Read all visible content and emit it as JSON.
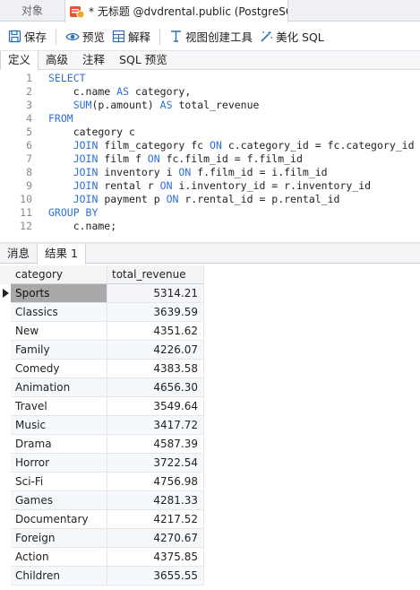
{
  "window_tabs": {
    "objects_label": "对象",
    "query_title": "* 无标题 @dvdrental.public (PostgreSQ..."
  },
  "toolbar": {
    "save_label": "保存",
    "preview_label": "预览",
    "explain_label": "解释",
    "view_builder_label": "视图创建工具",
    "beautify_label": "美化 SQL"
  },
  "sub_tabs": [
    "定义",
    "高级",
    "注释",
    "SQL 预览"
  ],
  "code": {
    "lines": [
      {
        "n": "1",
        "parts": [
          {
            "t": "SELECT",
            "k": true
          }
        ]
      },
      {
        "n": "2",
        "parts": [
          {
            "t": "    c.name ",
            "k": false
          },
          {
            "t": "AS",
            "k": true
          },
          {
            "t": " category,",
            "k": false
          }
        ]
      },
      {
        "n": "3",
        "parts": [
          {
            "t": "    ",
            "k": false
          },
          {
            "t": "SUM",
            "k": true
          },
          {
            "t": "(p.amount) ",
            "k": false
          },
          {
            "t": "AS",
            "k": true
          },
          {
            "t": " total_revenue",
            "k": false
          }
        ]
      },
      {
        "n": "4",
        "parts": [
          {
            "t": "FROM",
            "k": true
          }
        ]
      },
      {
        "n": "5",
        "parts": [
          {
            "t": "    category c",
            "k": false
          }
        ]
      },
      {
        "n": "6",
        "parts": [
          {
            "t": "    ",
            "k": false
          },
          {
            "t": "JOIN",
            "k": true
          },
          {
            "t": " film_category fc ",
            "k": false
          },
          {
            "t": "ON",
            "k": true
          },
          {
            "t": " c.category_id = fc.category_id",
            "k": false
          }
        ]
      },
      {
        "n": "7",
        "parts": [
          {
            "t": "    ",
            "k": false
          },
          {
            "t": "JOIN",
            "k": true
          },
          {
            "t": " film f ",
            "k": false
          },
          {
            "t": "ON",
            "k": true
          },
          {
            "t": " fc.film_id = f.film_id",
            "k": false
          }
        ]
      },
      {
        "n": "8",
        "parts": [
          {
            "t": "    ",
            "k": false
          },
          {
            "t": "JOIN",
            "k": true
          },
          {
            "t": " inventory i ",
            "k": false
          },
          {
            "t": "ON",
            "k": true
          },
          {
            "t": " f.film_id = i.film_id",
            "k": false
          }
        ]
      },
      {
        "n": "9",
        "parts": [
          {
            "t": "    ",
            "k": false
          },
          {
            "t": "JOIN",
            "k": true
          },
          {
            "t": " rental r ",
            "k": false
          },
          {
            "t": "ON",
            "k": true
          },
          {
            "t": " i.inventory_id = r.inventory_id",
            "k": false
          }
        ]
      },
      {
        "n": "10",
        "parts": [
          {
            "t": "    ",
            "k": false
          },
          {
            "t": "JOIN",
            "k": true
          },
          {
            "t": " payment p ",
            "k": false
          },
          {
            "t": "ON",
            "k": true
          },
          {
            "t": " r.rental_id = p.rental_id",
            "k": false
          }
        ]
      },
      {
        "n": "11",
        "parts": [
          {
            "t": "GROUP BY",
            "k": true
          }
        ]
      },
      {
        "n": "12",
        "parts": [
          {
            "t": "    c.name;",
            "k": false
          }
        ]
      }
    ]
  },
  "result_tabs": [
    "消息",
    "结果 1"
  ],
  "results": {
    "columns": [
      "category",
      "total_revenue"
    ],
    "rows": [
      [
        "Sports",
        "5314.21"
      ],
      [
        "Classics",
        "3639.59"
      ],
      [
        "New",
        "4351.62"
      ],
      [
        "Family",
        "4226.07"
      ],
      [
        "Comedy",
        "4383.58"
      ],
      [
        "Animation",
        "4656.30"
      ],
      [
        "Travel",
        "3549.64"
      ],
      [
        "Music",
        "3417.72"
      ],
      [
        "Drama",
        "4587.39"
      ],
      [
        "Horror",
        "3722.54"
      ],
      [
        "Sci-Fi",
        "4756.98"
      ],
      [
        "Games",
        "4281.33"
      ],
      [
        "Documentary",
        "4217.52"
      ],
      [
        "Foreign",
        "4270.67"
      ],
      [
        "Action",
        "4375.85"
      ],
      [
        "Children",
        "3655.55"
      ]
    ]
  },
  "colors": {
    "keyword": "#2e6fd6",
    "selected_cell": "#a9a9a9"
  }
}
